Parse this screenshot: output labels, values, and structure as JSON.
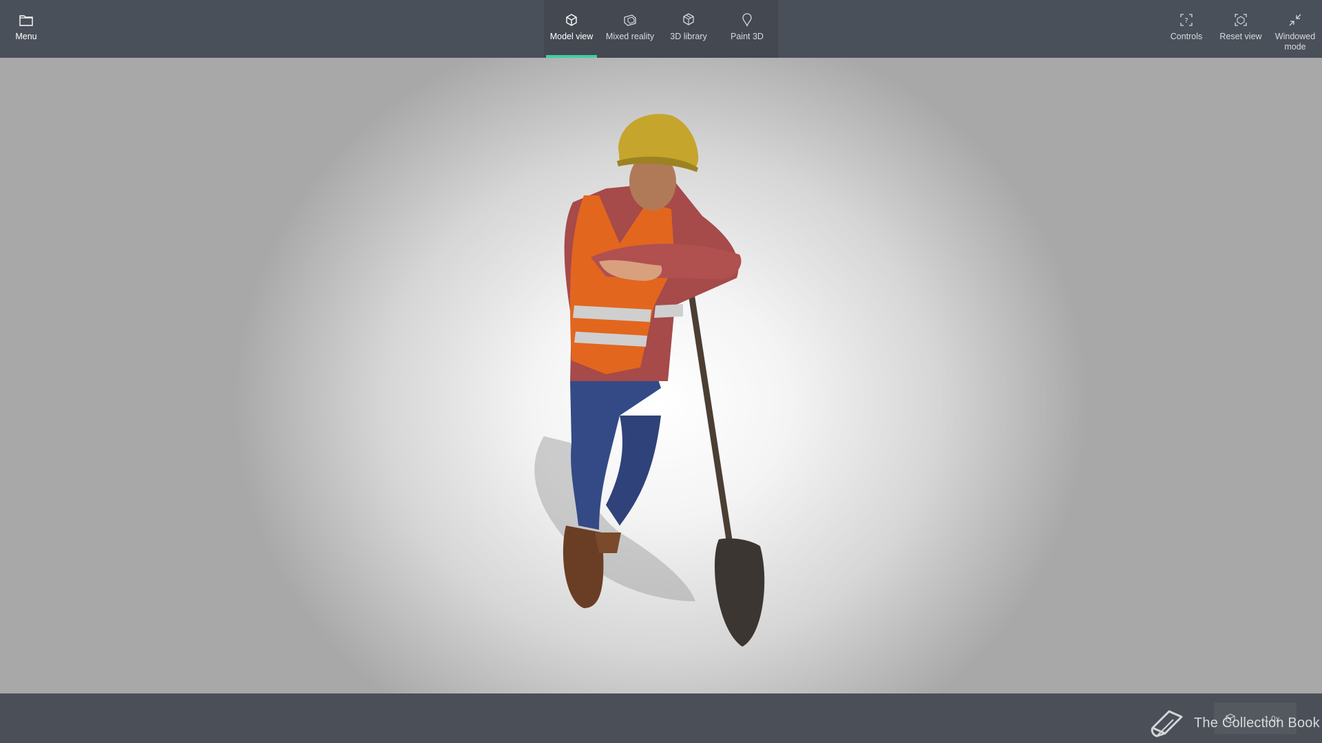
{
  "toolbar": {
    "menu": {
      "label": "Menu",
      "icon": "folder-icon"
    },
    "tabs": [
      {
        "label": "Model view",
        "icon": "cube-icon",
        "active": true
      },
      {
        "label": "Mixed reality",
        "icon": "mixed-reality-icon",
        "active": false
      },
      {
        "label": "3D library",
        "icon": "cubes-icon",
        "active": false
      },
      {
        "label": "Paint 3D",
        "icon": "paint-drop-icon",
        "active": false
      }
    ],
    "right": [
      {
        "label": "Controls",
        "icon": "controls-help-icon"
      },
      {
        "label": "Reset view",
        "icon": "reset-view-icon"
      },
      {
        "label": "Windowed mode",
        "icon": "collapse-arrows-icon"
      }
    ]
  },
  "status": {
    "zoom_level": "1.0x"
  },
  "watermark": {
    "text": "The Collection Book",
    "icon": "book-icon"
  },
  "colors": {
    "toolbar_bg": "#4a5059",
    "tab_group_bg": "#434851",
    "active_underline": "#3fd0a5",
    "viewport_center": "#ffffff",
    "viewport_edge": "#a8a8a8"
  }
}
